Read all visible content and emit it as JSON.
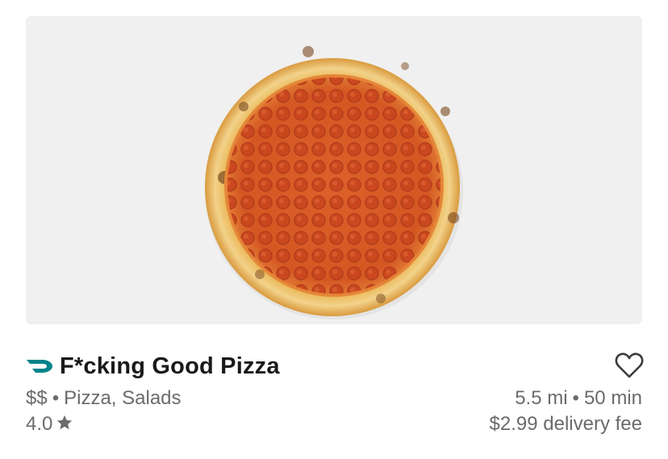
{
  "store": {
    "name": "F*cking Good Pizza",
    "price_range": "$$",
    "separator": "•",
    "cuisines": "Pizza, Salads",
    "rating": "4.0",
    "distance": "5.5 mi",
    "eta": "50 min",
    "delivery_fee": "$2.99 delivery fee"
  },
  "icons": {
    "dashpass": "dashpass-icon",
    "favorite": "heart-icon",
    "rating": "star-icon"
  },
  "colors": {
    "dashpass_teal": "#00838a",
    "title_text": "#191919",
    "meta_text": "#6b6b6b",
    "image_bg": "#f0f0f0"
  }
}
